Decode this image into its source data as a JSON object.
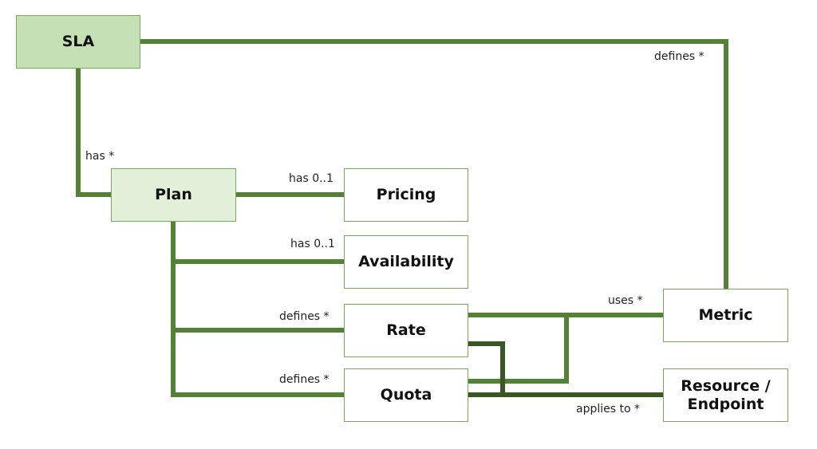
{
  "colors": {
    "line": "#548235",
    "line_dark": "#385723",
    "sla_fill": "#c5e0b4",
    "plan_fill": "#e2f0d9",
    "border": "#7aa95a"
  },
  "nodes": {
    "sla": "SLA",
    "plan": "Plan",
    "pricing": "Pricing",
    "availability": "Availability",
    "rate": "Rate",
    "quota": "Quota",
    "metric": "Metric",
    "resource": "Resource / Endpoint"
  },
  "edges": {
    "sla_metric": "defines *",
    "sla_plan": "has *",
    "plan_pricing": "has 0..1",
    "plan_availability": "has 0..1",
    "plan_rate": "defines *",
    "plan_quota": "defines *",
    "rate_quota_metric": "uses *",
    "rate_quota_resource": "applies to *"
  }
}
